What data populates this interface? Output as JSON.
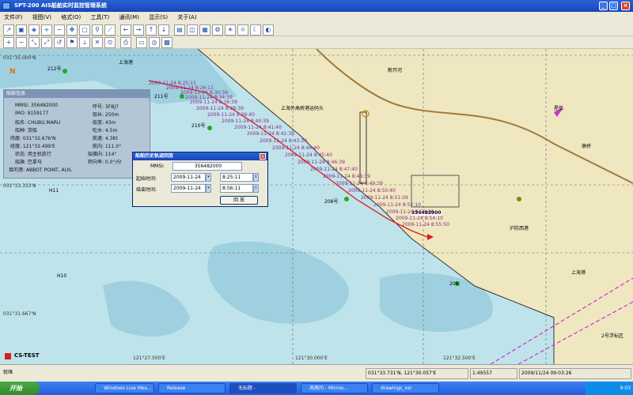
{
  "window": {
    "title": "SPT-200 AIS船舶实时监控管理系统",
    "controls": {
      "min": "_",
      "max": "□",
      "close": "×"
    }
  },
  "menu": [
    "文件(F)",
    "视图(V)",
    "格式(O)",
    "工具(T)",
    "通讯(M)",
    "显示(S)",
    "关于(A)"
  ],
  "map": {
    "top_left_lat": "031°35.000'N",
    "mid_lat": "031°33.333'N",
    "lower_lat": "031°31.667'N",
    "bottom_lons": [
      "121°27.500'E",
      "121°30.000'E",
      "121°32.500'E"
    ],
    "place_labels": [
      "上海港",
      "新开河",
      "上海外高桥港运码头",
      "星航",
      "墩桥",
      "208号",
      "210号",
      "211号",
      "212号",
      "H11",
      "H10",
      "208",
      "沪防西港",
      "上海港",
      "2号浮标区"
    ],
    "ship_label": "356482000",
    "track_times": [
      "2009-11-24 8:25:11",
      "2009-11-24 8:26:11",
      "2009-11-24 8:30:39",
      "2009-11-24 8:34:39",
      "2009-11-24 8:36:39",
      "2009-11-24 8:38:39",
      "2009-11-24 8:39:40",
      "2009-11-24 8:40:39",
      "2009-11-24 8:41:40",
      "2009-11-24 8:42:39",
      "2009-11-24 8:43:39",
      "2009-11-24 8:44:40",
      "2009-11-24 8:45:40",
      "2009-11-24 8:46:39",
      "2009-11-24 8:47:40",
      "2009-11-24 8:48:39",
      "2009-11-24 8:49:39",
      "2009-11-24 8:50:40",
      "2009-11-24 8:51:09",
      "2009-11-24 8:52:10",
      "2009-11-24 8:53:40",
      "2009-11-24 8:54:10",
      "2009-11-24 8:55:50"
    ],
    "cs_test": "CS-TEST",
    "north_label": "N"
  },
  "info_panel": {
    "title": "船舶信息",
    "rows": [
      [
        "MMSI: 356482000",
        "呼号: 3FBJ7"
      ],
      [
        "IMO: 9159177",
        "船长: 250m"
      ],
      [
        "船名: CHUBU.MARU",
        "船宽: 43m"
      ],
      [
        "船种: 货船",
        "吃水: 4.5m"
      ],
      [
        "纬度: 031°32.676'N",
        "航速: 4.3Kt"
      ],
      [
        "经度: 121°32.499'E",
        "航向: 111.0°"
      ],
      [
        "状态: 用主机航行",
        "船艏向: 114°"
      ],
      [
        "船旗: 巴拿马",
        "转向率: 0.0°/分"
      ],
      [
        "目的港: ABBOT POINT, AUS.",
        ""
      ]
    ]
  },
  "dialog": {
    "title": "船舶历史轨迹回放",
    "mmsi_label": "MMSI:",
    "mmsi_value": "356482000",
    "start_label": "起始时间:",
    "start_date": "2009-11-24",
    "start_time": "8:25:11",
    "end_label": "结束时间:",
    "end_date": "2009-11-24",
    "end_time": "8:56:11",
    "play_button": "回 放"
  },
  "statusbar": {
    "ready": "就绪",
    "coords": "031°33.731'N, 121°30.057'E",
    "scale": "1:49557",
    "datetime": "2009/11/24 09:03:26"
  },
  "taskbar": {
    "start": "开始",
    "tasks": [
      "Windows Live Mes...",
      "Release",
      "无标题 -",
      "风雨问 - Micros...",
      "drawings_xsr"
    ],
    "clock": "9:03"
  },
  "colors": {
    "sea": "#bfe3ea",
    "shallow": "#9fd0e0",
    "land": "#efe7c0",
    "track": "#e01a1a",
    "label": "#2a2ad8"
  }
}
